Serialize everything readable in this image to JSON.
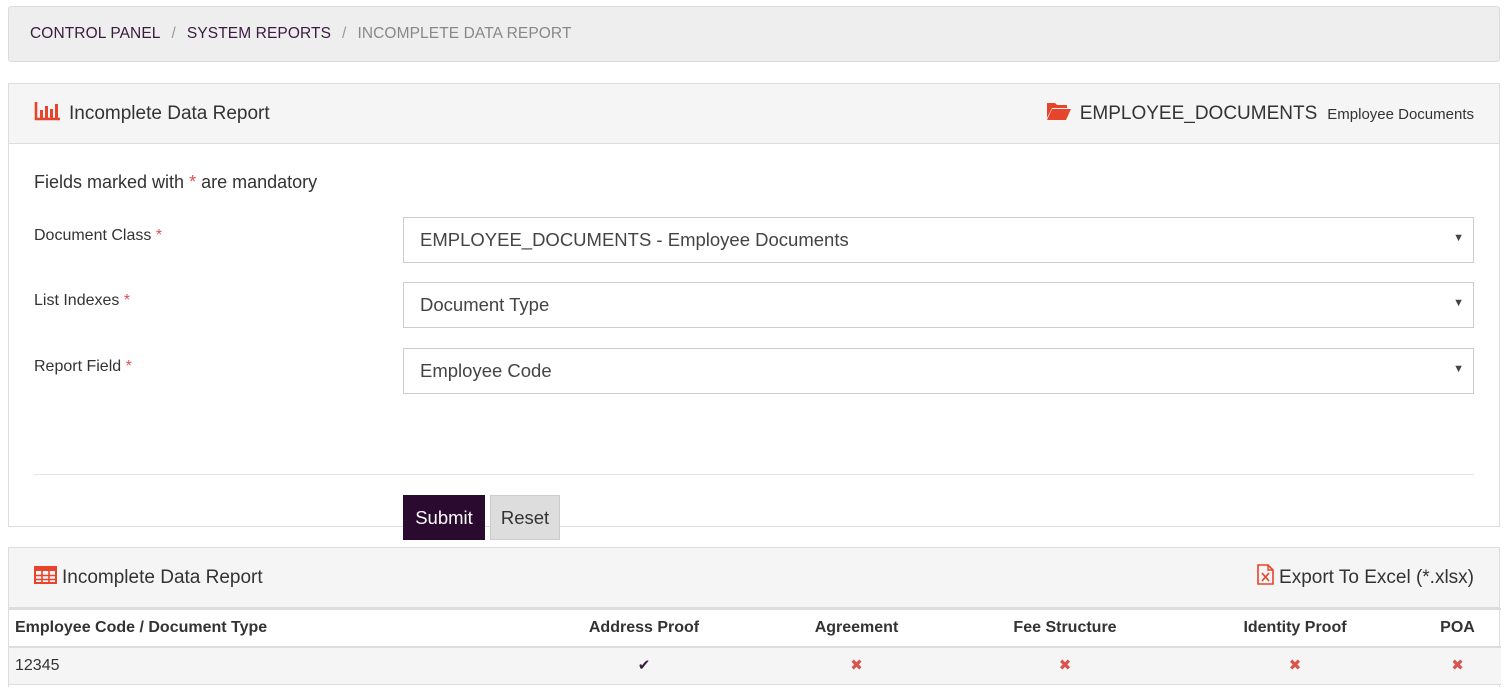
{
  "breadcrumb": {
    "items": [
      "CONTROL PANEL",
      "SYSTEM REPORTS"
    ],
    "separator": "/",
    "current": "INCOMPLETE DATA REPORT"
  },
  "form_panel": {
    "title": "Incomplete Data Report",
    "title_icon": "bar-chart-icon",
    "class_icon": "folder-open-icon",
    "class_code": "EMPLOYEE_DOCUMENTS",
    "class_description": "Employee Documents",
    "mandatory_note_prefix": "Fields marked with",
    "mandatory_star": "*",
    "mandatory_note_suffix": "are mandatory",
    "fields": [
      {
        "label": "Document Class",
        "value": "EMPLOYEE_DOCUMENTS - Employee Documents"
      },
      {
        "label": "List Indexes",
        "value": "Document Type"
      },
      {
        "label": "Report Field",
        "value": "Employee Code"
      }
    ],
    "submit_label": "Submit",
    "reset_label": "Reset"
  },
  "report_panel": {
    "title": "Incomplete Data Report",
    "title_icon": "table-icon",
    "export_label": "Export To Excel (*.xlsx)",
    "export_icon": "excel-file-icon",
    "columns": [
      "Employee Code / Document Type",
      "Address Proof",
      "Agreement",
      "Fee Structure",
      "Identity Proof",
      "POA"
    ],
    "rows": [
      {
        "code": "12345",
        "marks": [
          "✔",
          "✖",
          "✖",
          "✖",
          "✖"
        ]
      }
    ]
  },
  "colors": {
    "accent": "#e8442c",
    "primary_button": "#2b0a2f",
    "required": "#d9534f",
    "check": "#3a1a3f"
  }
}
